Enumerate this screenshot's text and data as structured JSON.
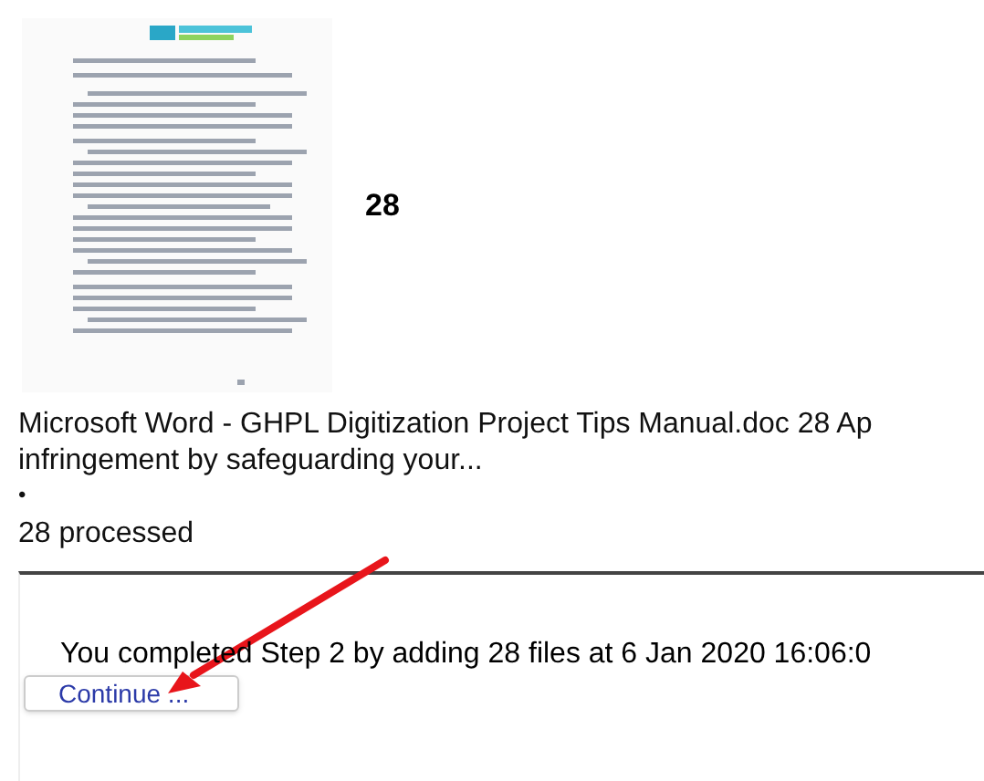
{
  "result": {
    "count": "28",
    "title": "Microsoft Word - GHPL Digitization Project Tips Manual.doc 28 Ap",
    "snippet": "infringement by safeguarding your...",
    "bullet": "•"
  },
  "processed": "28 processed",
  "completion": {
    "message": "You completed Step 2 by adding 28 files at 6 Jan 2020 16:06:0",
    "button": "Continue ..."
  }
}
